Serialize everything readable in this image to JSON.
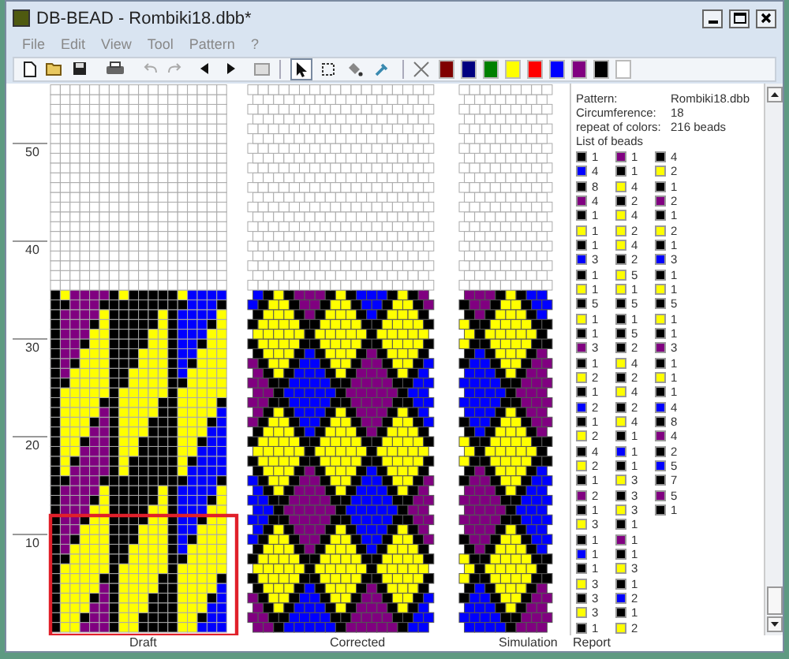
{
  "window": {
    "title": "DB-BEAD - Rombiki18.dbb*"
  },
  "menu": [
    "File",
    "Edit",
    "View",
    "Tool",
    "Pattern",
    "?"
  ],
  "tools": [
    {
      "selected": true
    },
    {
      "selected": false
    },
    {
      "selected": false
    },
    {
      "selected": false
    }
  ],
  "palette": [
    {
      "color": "#800000"
    },
    {
      "color": "#000080"
    },
    {
      "color": "#008000"
    },
    {
      "color": "#ffff00"
    },
    {
      "color": "#ff0000"
    },
    {
      "color": "#0000ff"
    },
    {
      "color": "#800080"
    },
    {
      "color": "#000000"
    },
    {
      "color": "#ffffff"
    }
  ],
  "axis_labels": [
    "50",
    "40",
    "30",
    "20",
    "10"
  ],
  "view_labels": [
    "Draft",
    "Corrected",
    "Simulation"
  ],
  "info": [
    {
      "label": "Pattern:",
      "value": "Rombiki18.dbb"
    },
    {
      "label": "Circumference:",
      "value": "18"
    },
    {
      "label": "repeat of colors:",
      "value": "216 beads"
    }
  ],
  "list_title": "List of beads",
  "bead_columns": [
    [
      {
        "color": "#000000",
        "count": "1"
      },
      {
        "color": "#0000ff",
        "count": "4"
      },
      {
        "color": "#000000",
        "count": "8"
      },
      {
        "color": "#800080",
        "count": "4"
      },
      {
        "color": "#000000",
        "count": "1"
      },
      {
        "color": "#ffff00",
        "count": "1"
      },
      {
        "color": "#000000",
        "count": "1"
      },
      {
        "color": "#0000ff",
        "count": "3"
      },
      {
        "color": "#000000",
        "count": "1"
      },
      {
        "color": "#ffff00",
        "count": "1"
      },
      {
        "color": "#000000",
        "count": "5"
      },
      {
        "color": "#ffff00",
        "count": "1"
      },
      {
        "color": "#000000",
        "count": "1"
      },
      {
        "color": "#800080",
        "count": "3"
      },
      {
        "color": "#000000",
        "count": "1"
      },
      {
        "color": "#ffff00",
        "count": "2"
      },
      {
        "color": "#000000",
        "count": "1"
      },
      {
        "color": "#0000ff",
        "count": "2"
      },
      {
        "color": "#000000",
        "count": "1"
      },
      {
        "color": "#ffff00",
        "count": "2"
      },
      {
        "color": "#000000",
        "count": "4"
      },
      {
        "color": "#ffff00",
        "count": "2"
      },
      {
        "color": "#000000",
        "count": "1"
      },
      {
        "color": "#800080",
        "count": "2"
      },
      {
        "color": "#000000",
        "count": "1"
      },
      {
        "color": "#ffff00",
        "count": "3"
      },
      {
        "color": "#000000",
        "count": "1"
      },
      {
        "color": "#0000ff",
        "count": "1"
      },
      {
        "color": "#000000",
        "count": "1"
      },
      {
        "color": "#ffff00",
        "count": "3"
      },
      {
        "color": "#000000",
        "count": "3"
      },
      {
        "color": "#ffff00",
        "count": "3"
      },
      {
        "color": "#000000",
        "count": "1"
      }
    ],
    [
      {
        "color": "#800080",
        "count": "1"
      },
      {
        "color": "#000000",
        "count": "1"
      },
      {
        "color": "#ffff00",
        "count": "4"
      },
      {
        "color": "#000000",
        "count": "2"
      },
      {
        "color": "#ffff00",
        "count": "4"
      },
      {
        "color": "#ffff00",
        "count": "2"
      },
      {
        "color": "#ffff00",
        "count": "4"
      },
      {
        "color": "#000000",
        "count": "2"
      },
      {
        "color": "#ffff00",
        "count": "5"
      },
      {
        "color": "#ffff00",
        "count": "1"
      },
      {
        "color": "#000000",
        "count": "5"
      },
      {
        "color": "#000000",
        "count": "1"
      },
      {
        "color": "#000000",
        "count": "5"
      },
      {
        "color": "#000000",
        "count": "2"
      },
      {
        "color": "#ffff00",
        "count": "4"
      },
      {
        "color": "#000000",
        "count": "2"
      },
      {
        "color": "#ffff00",
        "count": "4"
      },
      {
        "color": "#000000",
        "count": "2"
      },
      {
        "color": "#ffff00",
        "count": "4"
      },
      {
        "color": "#000000",
        "count": "1"
      },
      {
        "color": "#0000ff",
        "count": "1"
      },
      {
        "color": "#000000",
        "count": "1"
      },
      {
        "color": "#ffff00",
        "count": "3"
      },
      {
        "color": "#000000",
        "count": "3"
      },
      {
        "color": "#ffff00",
        "count": "3"
      },
      {
        "color": "#000000",
        "count": "1"
      },
      {
        "color": "#800080",
        "count": "1"
      },
      {
        "color": "#000000",
        "count": "1"
      },
      {
        "color": "#ffff00",
        "count": "3"
      },
      {
        "color": "#000000",
        "count": "1"
      },
      {
        "color": "#0000ff",
        "count": "2"
      },
      {
        "color": "#000000",
        "count": "1"
      },
      {
        "color": "#ffff00",
        "count": "2"
      }
    ],
    [
      {
        "color": "#000000",
        "count": "4"
      },
      {
        "color": "#ffff00",
        "count": "2"
      },
      {
        "color": "#000000",
        "count": "1"
      },
      {
        "color": "#800080",
        "count": "2"
      },
      {
        "color": "#000000",
        "count": "1"
      },
      {
        "color": "#ffff00",
        "count": "2"
      },
      {
        "color": "#000000",
        "count": "1"
      },
      {
        "color": "#0000ff",
        "count": "3"
      },
      {
        "color": "#000000",
        "count": "1"
      },
      {
        "color": "#ffff00",
        "count": "1"
      },
      {
        "color": "#000000",
        "count": "5"
      },
      {
        "color": "#ffff00",
        "count": "1"
      },
      {
        "color": "#000000",
        "count": "1"
      },
      {
        "color": "#800080",
        "count": "3"
      },
      {
        "color": "#000000",
        "count": "1"
      },
      {
        "color": "#ffff00",
        "count": "1"
      },
      {
        "color": "#000000",
        "count": "1"
      },
      {
        "color": "#0000ff",
        "count": "4"
      },
      {
        "color": "#000000",
        "count": "8"
      },
      {
        "color": "#800080",
        "count": "4"
      },
      {
        "color": "#000000",
        "count": "2"
      },
      {
        "color": "#0000ff",
        "count": "5"
      },
      {
        "color": "#000000",
        "count": "7"
      },
      {
        "color": "#800080",
        "count": "5"
      },
      {
        "color": "#000000",
        "count": "1"
      }
    ]
  ],
  "report_label": "Report"
}
